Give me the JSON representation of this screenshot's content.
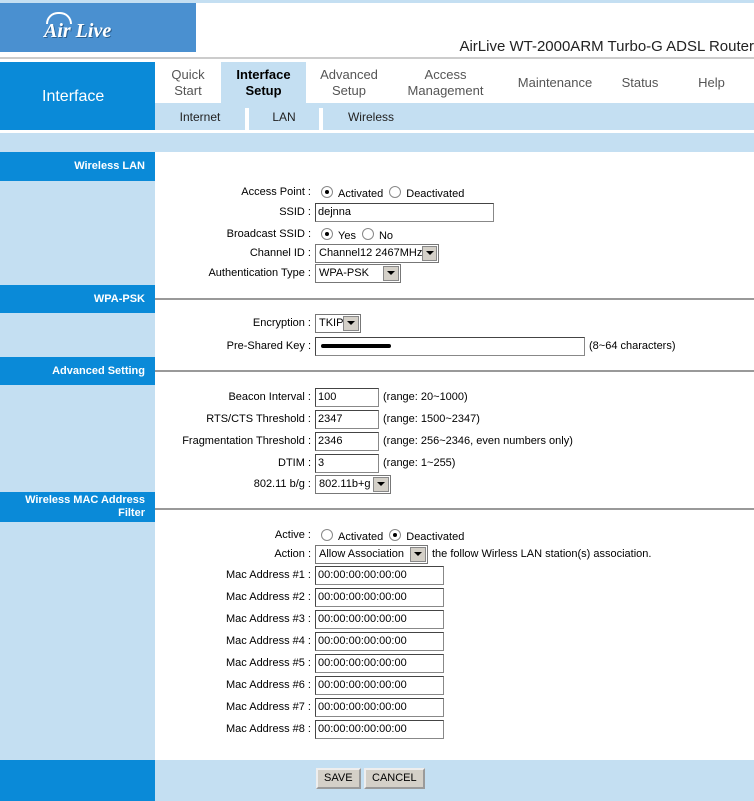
{
  "header": {
    "logo": "Air Live",
    "title": "AirLive WT-2000ARM Turbo-G ADSL Router"
  },
  "left_nav": {
    "label": "Interface"
  },
  "tabs": [
    {
      "label": "Quick Start",
      "active": false
    },
    {
      "label": "Interface Setup",
      "active": true
    },
    {
      "label": "Advanced Setup",
      "active": false
    },
    {
      "label": "Access Management",
      "active": false
    },
    {
      "label": "Maintenance",
      "active": false
    },
    {
      "label": "Status",
      "active": false
    },
    {
      "label": "Help",
      "active": false
    }
  ],
  "subtabs": [
    {
      "label": "Internet"
    },
    {
      "label": "LAN"
    },
    {
      "label": "Wireless"
    }
  ],
  "colors": {
    "brand_blue": "#0a8ad8",
    "light_blue": "#c4dff2",
    "logo_blue": "#4a90d0"
  },
  "sections": [
    {
      "title": "Wireless LAN",
      "rows": [
        {
          "label": "Access Point :",
          "type": "radio",
          "options": [
            "Activated",
            "Deactivated"
          ],
          "selected": 0
        },
        {
          "label": "SSID :",
          "type": "text",
          "value": "dejnna"
        },
        {
          "label": "Broadcast SSID :",
          "type": "radio",
          "options": [
            "Yes",
            "No"
          ],
          "selected": 0
        },
        {
          "label": "Channel ID :",
          "type": "select",
          "value": "Channel12 2467MHz"
        },
        {
          "label": "Authentication Type :",
          "type": "select",
          "value": "WPA-PSK"
        }
      ]
    },
    {
      "title": "WPA-PSK",
      "rows": [
        {
          "label": "Encryption :",
          "type": "select",
          "value": "TKIP"
        },
        {
          "label": "Pre-Shared Key :",
          "type": "password",
          "value": "••••••••••••",
          "note": "(8~64 characters)"
        }
      ]
    },
    {
      "title": "Advanced Setting",
      "rows": [
        {
          "label": "Beacon Interval :",
          "type": "text",
          "value": "100",
          "note": "(range: 20~1000)"
        },
        {
          "label": "RTS/CTS Threshold :",
          "type": "text",
          "value": "2347",
          "note": "(range: 1500~2347)"
        },
        {
          "label": "Fragmentation Threshold :",
          "type": "text",
          "value": "2346",
          "note": "(range: 256~2346, even numbers only)"
        },
        {
          "label": "DTIM :",
          "type": "text",
          "value": "3",
          "note": "(range: 1~255)"
        },
        {
          "label": "802.11 b/g :",
          "type": "select",
          "value": "802.11b+g"
        }
      ]
    },
    {
      "title": "Wireless MAC Address Filter",
      "rows": [
        {
          "label": "Active :",
          "type": "radio",
          "options": [
            "Activated",
            "Deactivated"
          ],
          "selected": 1
        },
        {
          "label": "Action :",
          "type": "select",
          "value": "Allow Association",
          "note": "the follow Wirless LAN station(s) association."
        },
        {
          "label": "Mac Address #1 :",
          "type": "text",
          "value": "00:00:00:00:00:00"
        },
        {
          "label": "Mac Address #2 :",
          "type": "text",
          "value": "00:00:00:00:00:00"
        },
        {
          "label": "Mac Address #3 :",
          "type": "text",
          "value": "00:00:00:00:00:00"
        },
        {
          "label": "Mac Address #4 :",
          "type": "text",
          "value": "00:00:00:00:00:00"
        },
        {
          "label": "Mac Address #5 :",
          "type": "text",
          "value": "00:00:00:00:00:00"
        },
        {
          "label": "Mac Address #6 :",
          "type": "text",
          "value": "00:00:00:00:00:00"
        },
        {
          "label": "Mac Address #7 :",
          "type": "text",
          "value": "00:00:00:00:00:00"
        },
        {
          "label": "Mac Address #8 :",
          "type": "text",
          "value": "00:00:00:00:00:00"
        }
      ]
    }
  ],
  "buttons": {
    "save": "SAVE",
    "cancel": "CANCEL"
  }
}
